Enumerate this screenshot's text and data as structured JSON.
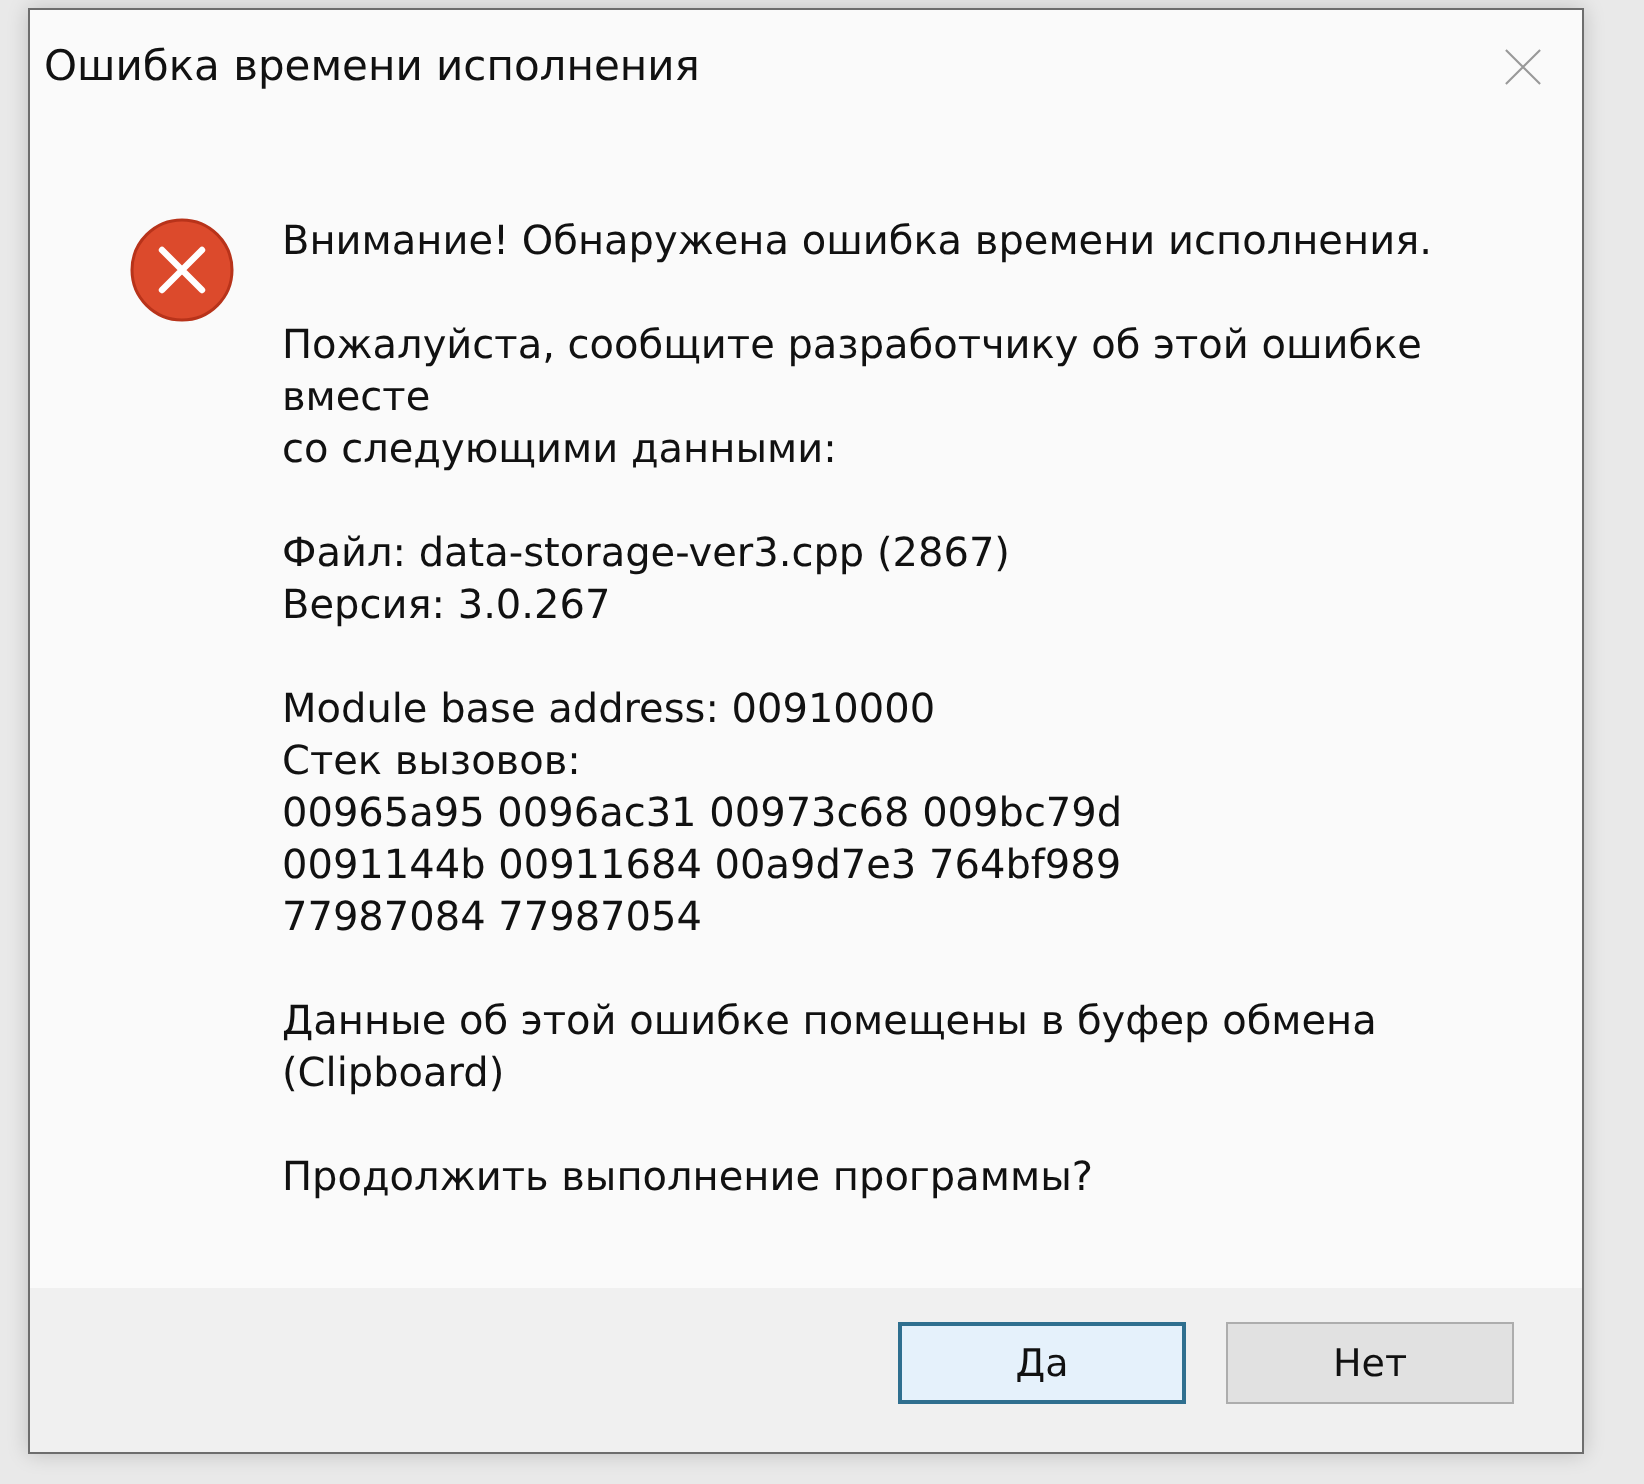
{
  "window": {
    "title": "Ошибка времени исполнения"
  },
  "message": {
    "paragraphs": [
      {
        "lines": [
          "Внимание! Обнаружена ошибка времени исполнения."
        ]
      },
      {
        "lines": [
          "Пожалуйста, сообщите разработчику об этой ошибке",
          "вместе",
          "со следующими данными:"
        ]
      },
      {
        "lines": [
          "Файл: data-storage-ver3.cpp (2867)",
          "Версия: 3.0.267"
        ]
      },
      {
        "lines": [
          "Module base address: 00910000",
          "Стек вызовов:",
          "00965a95 0096ac31 00973c68 009bc79d",
          "0091144b 00911684 00a9d7e3 764bf989",
          "77987084 77987054"
        ]
      },
      {
        "lines": [
          "Данные об этой ошибке помещены в буфер обмена",
          "(Clipboard)"
        ]
      },
      {
        "lines": [
          "Продолжить выполнение программы?"
        ]
      }
    ]
  },
  "buttons": [
    {
      "label": "Да",
      "default": true
    },
    {
      "label": "Нет",
      "default": false
    }
  ]
}
